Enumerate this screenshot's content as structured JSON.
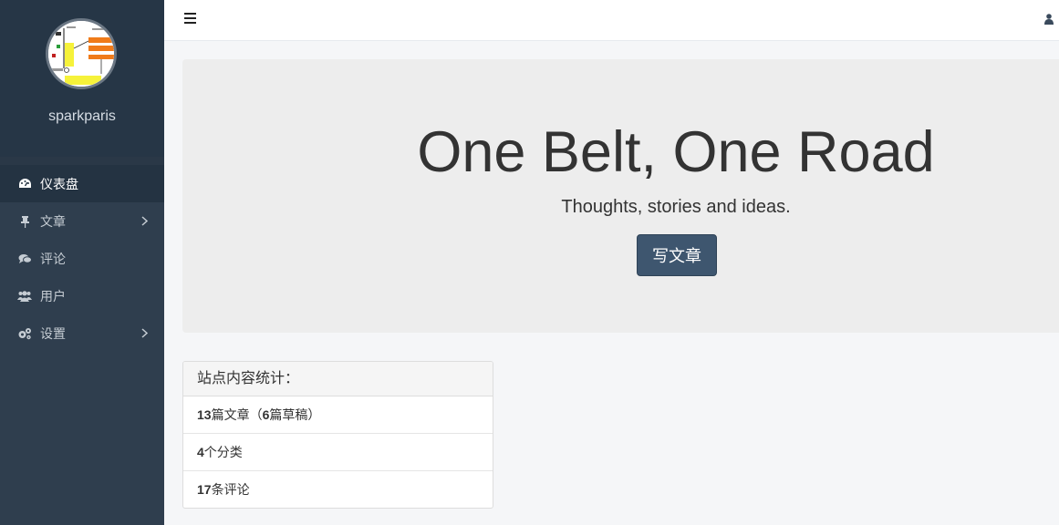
{
  "sidebar": {
    "username": "sparkparis",
    "menu": [
      {
        "label": "仪表盘",
        "icon": "dashboard-icon",
        "active": true
      },
      {
        "label": "文章",
        "icon": "thumbtack-icon",
        "has_children": true
      },
      {
        "label": "评论",
        "icon": "comments-icon"
      },
      {
        "label": "用户",
        "icon": "users-icon"
      },
      {
        "label": "设置",
        "icon": "gears-icon",
        "has_children": true
      }
    ]
  },
  "topbar": {
    "menu_icon": "hamburger-icon",
    "user_icon": "user-icon"
  },
  "jumbotron": {
    "title": "One Belt, One Road",
    "subtitle": "Thoughts, stories and ideas.",
    "button_label": "写文章"
  },
  "stats": {
    "heading": "站点内容统计：",
    "posts_count": "13",
    "posts_text": "篇文章（",
    "drafts_count": "6",
    "drafts_text": "篇草稿）",
    "categories_count": "4",
    "categories_text": "个分类",
    "comments_count": "17",
    "comments_text": "条评论"
  },
  "colors": {
    "sidebar_bg": "#2f3e4e",
    "sidebar_active": "#243342",
    "button_bg": "#3e566f",
    "jumbotron_bg": "#ededed"
  }
}
